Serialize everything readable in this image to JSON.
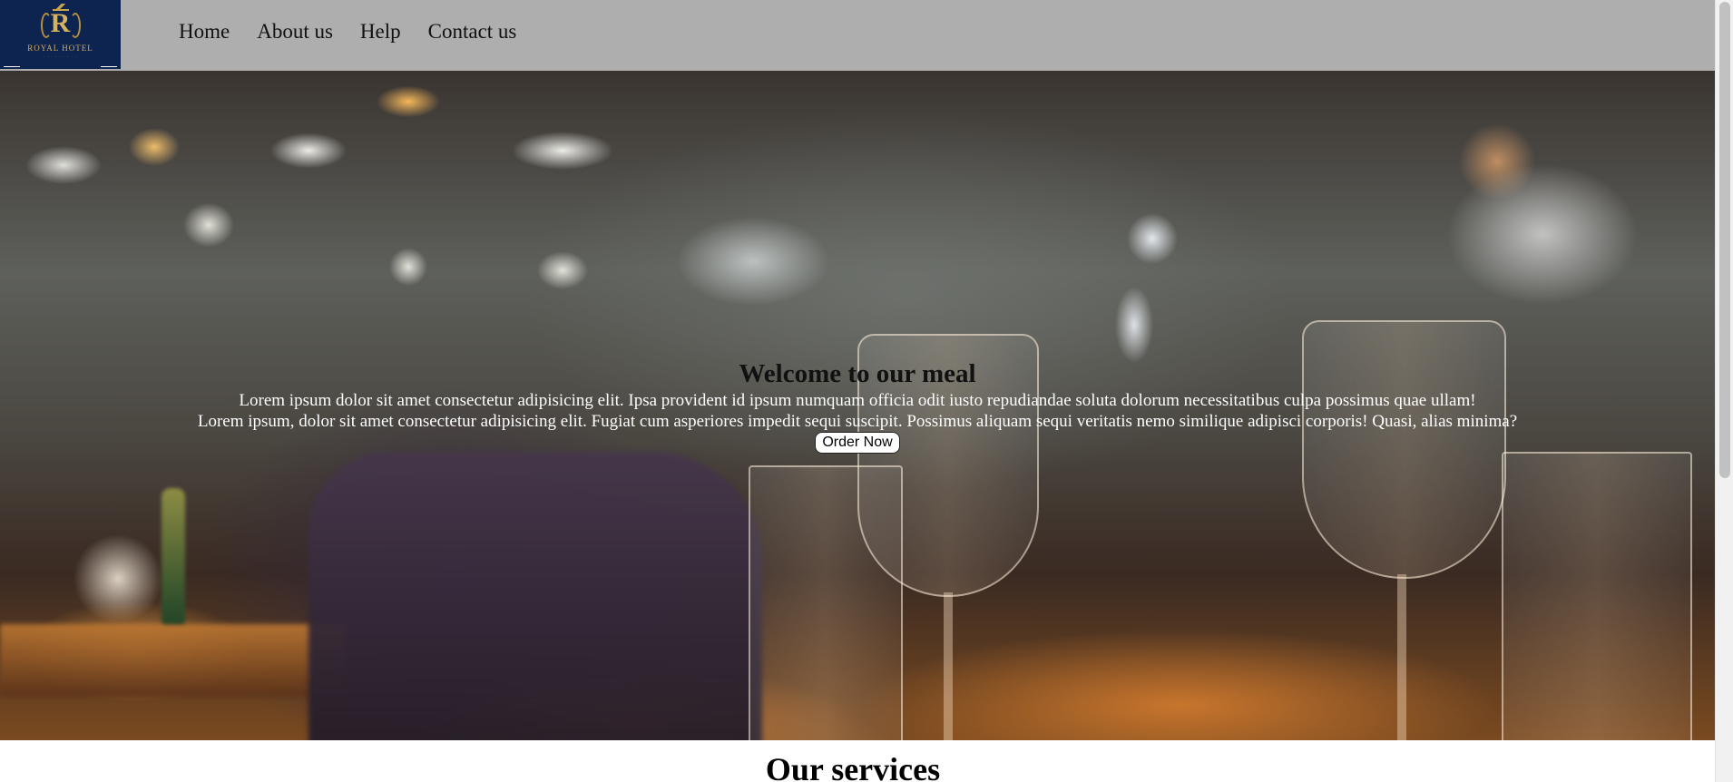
{
  "brand": {
    "logo_name": "ROYAL HOTEL",
    "logo_letter": "R"
  },
  "nav": {
    "items": [
      {
        "label": "Home"
      },
      {
        "label": "About us"
      },
      {
        "label": "Help"
      },
      {
        "label": "Contact us"
      }
    ]
  },
  "hero": {
    "title": "Welcome to our meal",
    "line1": "Lorem ipsum dolor sit amet consectetur adipisicing elit. Ipsa provident id ipsum numquam officia odit iusto repudiandae soluta dolorum necessitatibus culpa possimus quae ullam!",
    "line2": "Lorem ipsum, dolor sit amet consectetur adipisicing elit. Fugiat cum asperiores impedit sequi suscipit. Possimus aliquam sequi veritatis nemo similique adipisci corporis! Quasi, alias minima?",
    "button_label": "Order Now",
    "background": "blurred restaurant interior with wine glasses"
  },
  "services": {
    "title": "Our services"
  },
  "colors": {
    "navbar": "#afaeaf",
    "logo_bg": "#0d2350",
    "logo_gold": "#d6b15e"
  },
  "icons": {
    "logo": "royal-hotel-crest-icon"
  }
}
